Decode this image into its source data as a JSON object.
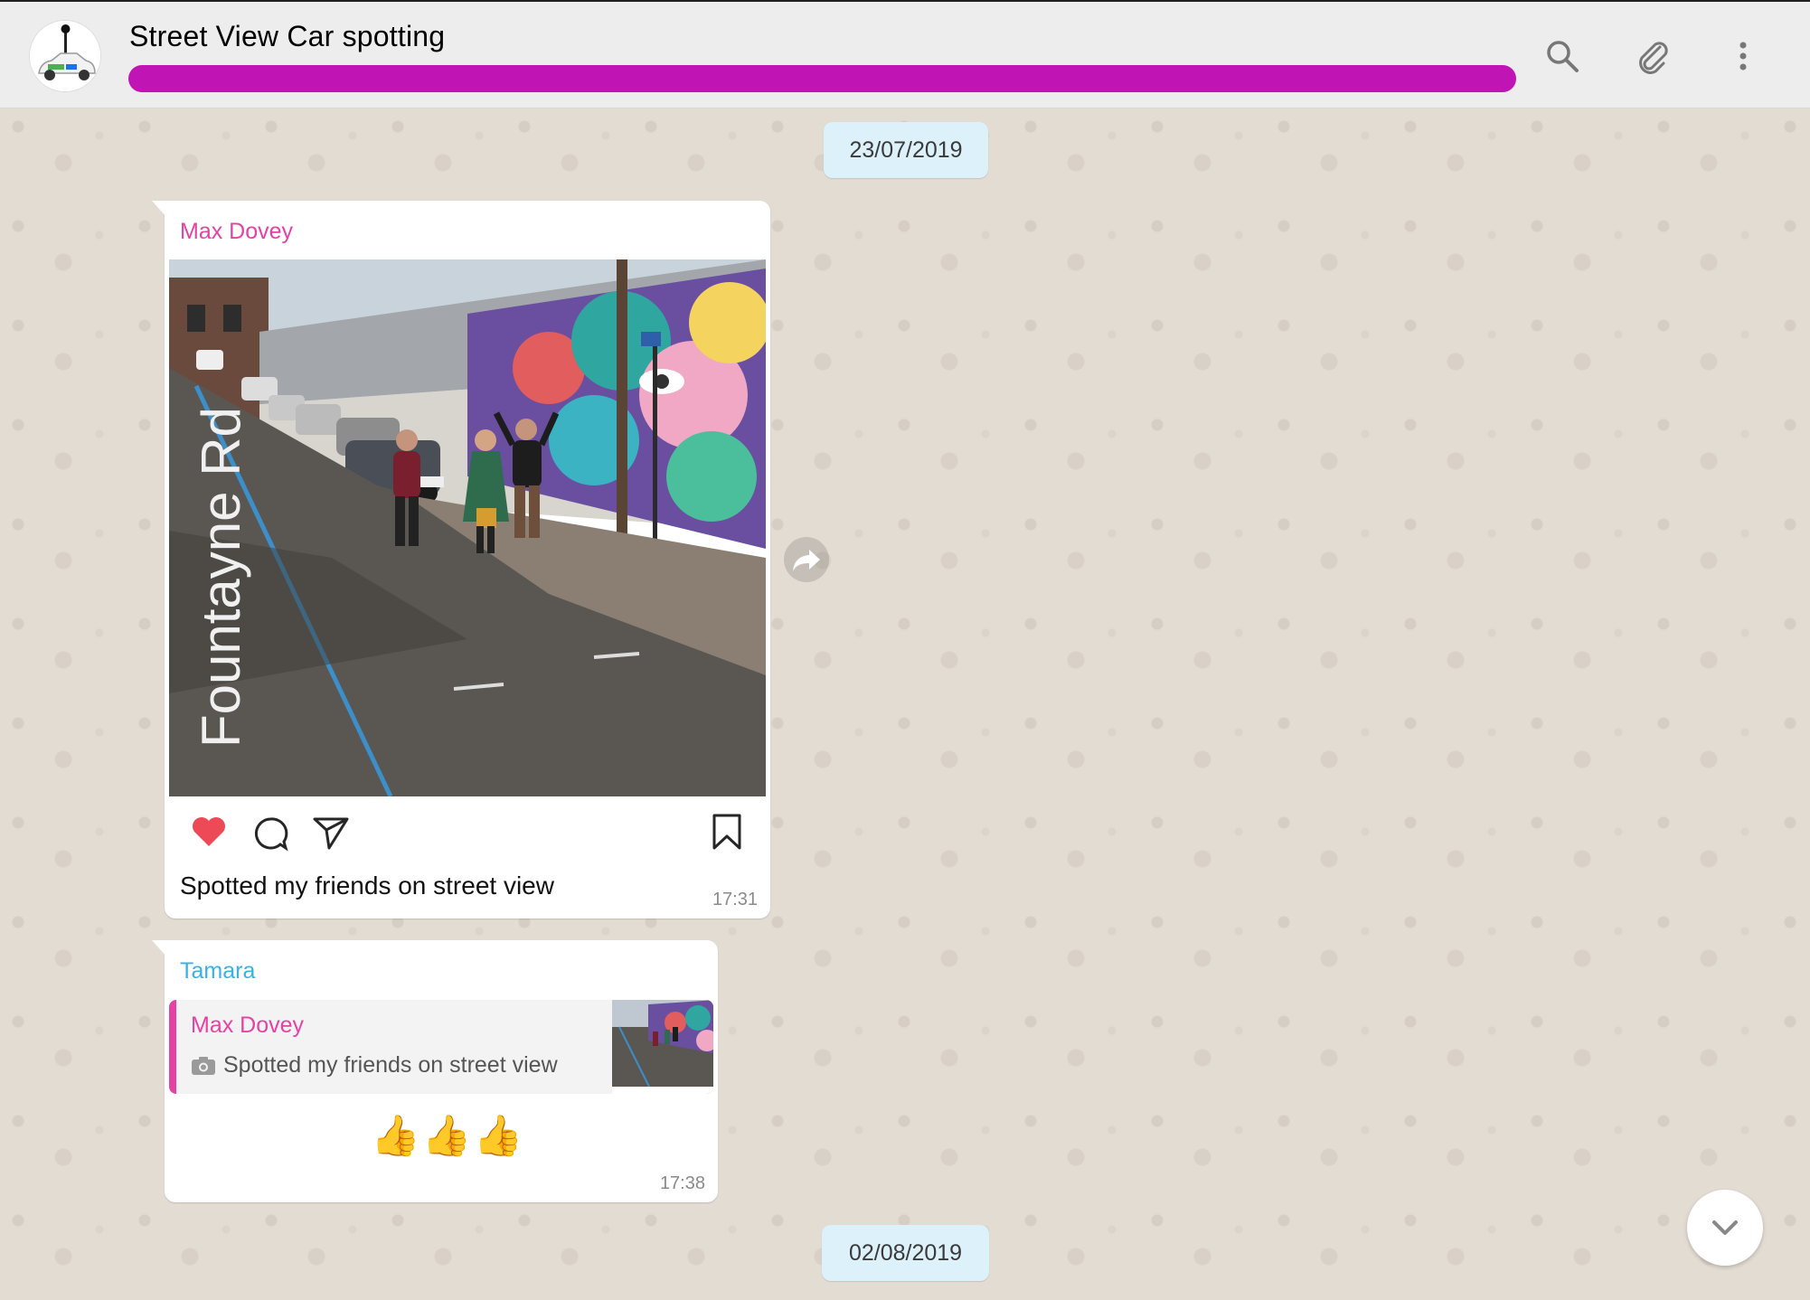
{
  "header": {
    "title": "Street View Car spotting",
    "icons": [
      "search-icon",
      "paperclip-icon",
      "more-vertical-icon"
    ]
  },
  "dates": [
    "23/07/2019",
    "02/08/2019"
  ],
  "messages": [
    {
      "sender": "Max Dovey",
      "caption": "Spotted my friends on street view",
      "time": "17:31",
      "image_text": "Fountayne Rd",
      "icons": [
        "heart-icon",
        "comment-icon",
        "send-icon",
        "bookmark-icon"
      ]
    },
    {
      "sender": "Tamara",
      "quote": {
        "author": "Max Dovey",
        "text": "Spotted my friends on street view"
      },
      "body": "👍👍👍",
      "time": "17:38"
    }
  ],
  "colors": {
    "header_bg": "#ededed",
    "chat_bg": "#e5ddd5",
    "date_pill": "#dcf1fa",
    "sender_max": "#e542a3",
    "sender_tamara": "#35b3e7",
    "redaction": "#c014b5",
    "like_red": "#ed4956"
  }
}
